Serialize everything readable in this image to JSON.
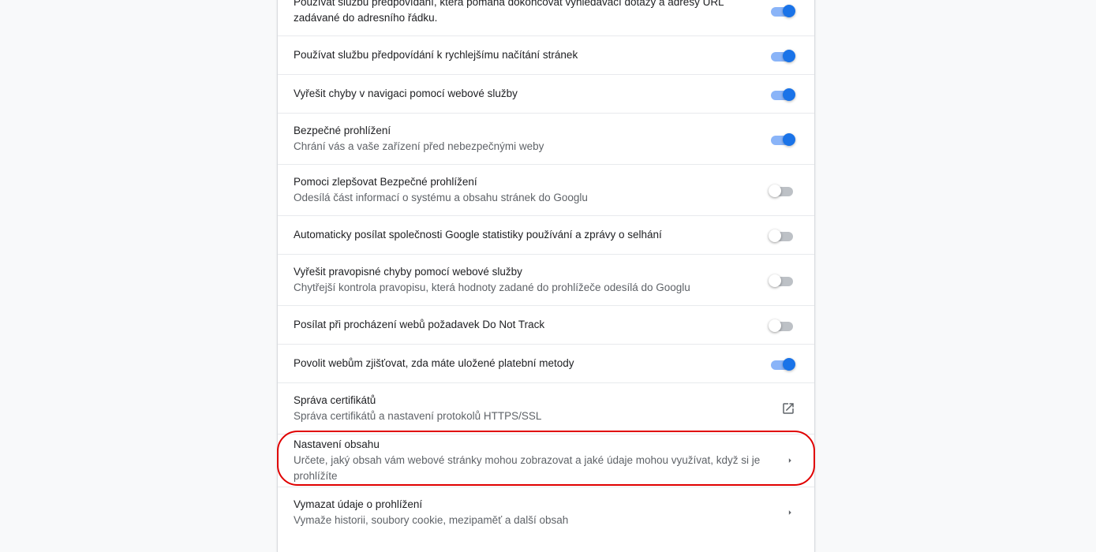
{
  "settings": [
    {
      "label": "Používat službu předpovídání, která pomáhá dokončovat vyhledávací dotazy a adresy URL zadávané do adresního řádku.",
      "sublabel": "",
      "control": "toggle",
      "state": "on"
    },
    {
      "label": "Používat službu předpovídání k rychlejšímu načítání stránek",
      "sublabel": "",
      "control": "toggle",
      "state": "on"
    },
    {
      "label": "Vyřešit chyby v navigaci pomocí webové služby",
      "sublabel": "",
      "control": "toggle",
      "state": "on"
    },
    {
      "label": "Bezpečné prohlížení",
      "sublabel": "Chrání vás a vaše zařízení před nebezpečnými weby",
      "control": "toggle",
      "state": "on"
    },
    {
      "label": "Pomoci zlepšovat Bezpečné prohlížení",
      "sublabel": "Odesílá část informací o systému a obsahu stránek do Googlu",
      "control": "toggle",
      "state": "off"
    },
    {
      "label": "Automaticky posílat společnosti Google statistiky používání a zprávy o selhání",
      "sublabel": "",
      "control": "toggle",
      "state": "off"
    },
    {
      "label": "Vyřešit pravopisné chyby pomocí webové služby",
      "sublabel": "Chytřejší kontrola pravopisu, která hodnoty zadané do prohlížeče odesílá do Googlu",
      "control": "toggle",
      "state": "off"
    },
    {
      "label": "Posílat při procházení webů požadavek Do Not Track",
      "sublabel": "",
      "control": "toggle",
      "state": "off"
    },
    {
      "label": "Povolit webům zjišťovat, zda máte uložené platební metody",
      "sublabel": "",
      "control": "toggle",
      "state": "on"
    },
    {
      "label": "Správa certifikátů",
      "sublabel": "Správa certifikátů a nastavení protokolů HTTPS/SSL",
      "control": "external-link-icon"
    },
    {
      "label": "Nastavení obsahu",
      "sublabel": "Určete, jaký obsah vám webové stránky mohou zobrazovat a jaké údaje mohou využívat, když si je prohlížíte",
      "control": "arrow-right-icon"
    },
    {
      "label": "Vymazat údaje o prohlížení",
      "sublabel": "Vymaže historii, soubory cookie, mezipaměť a další obsah",
      "control": "arrow-right-icon"
    }
  ],
  "colors": {
    "toggle_on_knob": "#1a73e8",
    "toggle_on_bar": "#8ab4f8",
    "toggle_off_bar": "#bdc1c6",
    "highlight": "#e00000"
  }
}
